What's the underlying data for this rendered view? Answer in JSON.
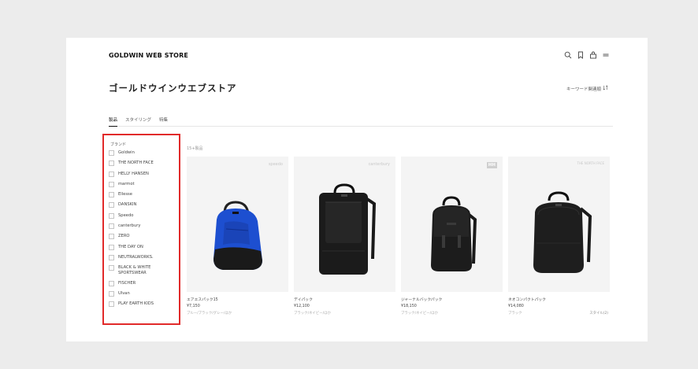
{
  "header": {
    "logo": "GOLDWIN WEB STORE",
    "icons": [
      "search-icon",
      "bookmark-icon",
      "cart-icon",
      "menu-icon"
    ]
  },
  "page": {
    "title": "ゴールドウインウエブストア",
    "sort_label": "キーワード関連順"
  },
  "tabs": [
    {
      "label": "製品",
      "active": true
    },
    {
      "label": "スタイリング",
      "active": false
    },
    {
      "label": "特集",
      "active": false
    }
  ],
  "filter": {
    "title": "ブランド",
    "brands": [
      "Goldwin",
      "THE NORTH FACE",
      "HELLY HANSEN",
      "marmot",
      "Ellesse",
      "DANSKIN",
      "Speedo",
      "canterbury",
      "ZERO",
      "THE DAY ON",
      "NEUTRALWORKS.",
      "BLACK & WHITE SPORTSWEAR",
      "FISCHER",
      "Ulvan",
      "PLAY EARTH KIDS"
    ],
    "highlight_color": "#e12a2a"
  },
  "results": {
    "count_label": "15+製品"
  },
  "products": [
    {
      "brand": "speedo",
      "name": "エアエスパック15",
      "price": "¥7,150",
      "colors": "ブルー/ブラック/グレー/ほか",
      "view_label": ""
    },
    {
      "brand": "canterbury",
      "name": "デイパック",
      "price": "¥12,100",
      "colors": "ブラック/ネイビー/ほか",
      "view_label": ""
    },
    {
      "brand": "HH",
      "name": "ジャーナルバックパック",
      "price": "¥18,150",
      "colors": "ブラック/ネイビー/ほか",
      "view_label": ""
    },
    {
      "brand": "THE NORTH FACE",
      "name": "ネオコンパクトパック",
      "price": "¥14,080",
      "colors": "ブラック",
      "view_label": "スタイル(2)"
    }
  ]
}
